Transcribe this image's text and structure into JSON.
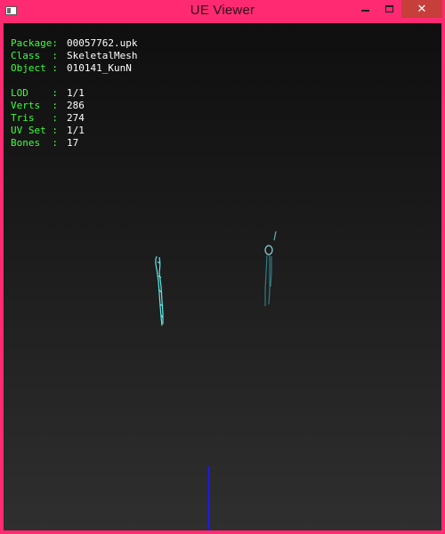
{
  "window": {
    "title": "UE Viewer",
    "close_glyph": "✕"
  },
  "info": {
    "package": {
      "label": "Package:",
      "value": "00057762.upk"
    },
    "class": {
      "label": "Class  :",
      "value": "SkeletalMesh"
    },
    "object": {
      "label": "Object :",
      "value": "010141_KunN"
    },
    "lod": {
      "label": "LOD    :",
      "value": "1/1"
    },
    "verts": {
      "label": "Verts  :",
      "value": "286"
    },
    "tris": {
      "label": "Tris   :",
      "value": "274"
    },
    "uvset": {
      "label": "UV Set :",
      "value": "1/1"
    },
    "bones": {
      "label": "Bones  :",
      "value": "17"
    }
  },
  "colors": {
    "frame": "#ff2a72",
    "label_green": "#3dff3d",
    "mesh_cyan": "#63e6e6",
    "mesh_teal": "#2f7d82",
    "axis_blue": "#1a1aff",
    "close_red": "#c63f3a"
  },
  "icons": {
    "app": "app-icon",
    "minimize": "minimize-icon",
    "maximize": "maximize-icon",
    "close": "close-icon"
  }
}
